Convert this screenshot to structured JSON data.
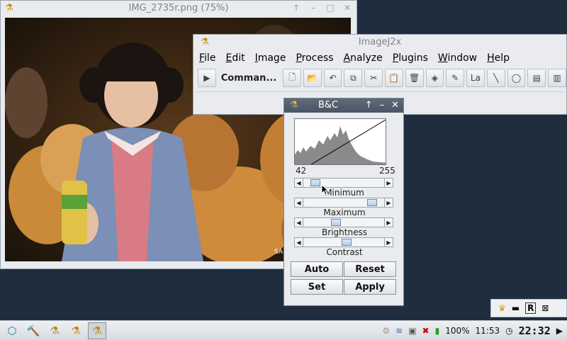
{
  "image_window": {
    "title": "IMG_2735r.png (75%)",
    "watermark": "SA"
  },
  "imagej_window": {
    "title": "ImageJ2x",
    "menus": [
      "File",
      "Edit",
      "Image",
      "Process",
      "Analyze",
      "Plugins",
      "Window",
      "Help"
    ],
    "command_label": "Comman...",
    "tools": [
      "new-icon",
      "open-icon",
      "undo-icon",
      "copy-icon",
      "cut-icon",
      "paste-icon",
      "delete-icon",
      "fill-icon",
      "pencil-icon",
      "label-icon",
      "line-icon",
      "oval-icon",
      "script-icon",
      "text-file-icon"
    ],
    "label_tool_text": "La"
  },
  "bc_dialog": {
    "title": "B&C",
    "range_min": "42",
    "range_max": "255",
    "sliders": {
      "minimum": {
        "label": "Minimum",
        "level": 0.1
      },
      "maximum": {
        "label": "Maximum",
        "level": 0.92
      },
      "brightness": {
        "label": "Brightness",
        "level": 0.4
      },
      "contrast": {
        "label": "Contrast",
        "level": 0.55
      }
    },
    "buttons": {
      "auto": "Auto",
      "reset": "Reset",
      "set": "Set",
      "apply": "Apply"
    }
  },
  "taskbar": {
    "battery": "100%",
    "battery_time": "11:53",
    "clock": "22:32"
  },
  "colors": {
    "desktop": "#1f2d3f",
    "dialog_title": "#4a5563",
    "accent": "#c38a10"
  }
}
